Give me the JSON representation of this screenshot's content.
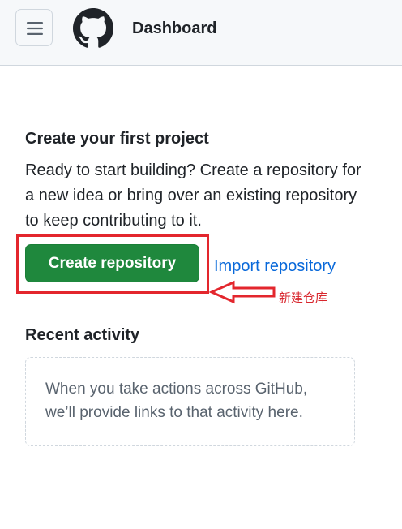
{
  "header": {
    "menu_icon": "hamburger-icon",
    "logo_icon": "github-logo-icon",
    "title": "Dashboard"
  },
  "first_project": {
    "title": "Create your first project",
    "description": "Ready to start building? Create a repository for a new idea or bring over an existing repository to keep contributing to it.",
    "create_button_label": "Create repository",
    "import_link_label": "Import repository"
  },
  "annotation": {
    "text": "新建仓库",
    "color": "#e3262d",
    "arrow_icon": "left-arrow-icon"
  },
  "recent_activity": {
    "title": "Recent activity",
    "empty_text": "When you take actions across GitHub, we’ll provide links to that activity here."
  },
  "colors": {
    "primary_button": "#1f883d",
    "link": "#0969da",
    "header_bg": "#f6f8fa"
  }
}
